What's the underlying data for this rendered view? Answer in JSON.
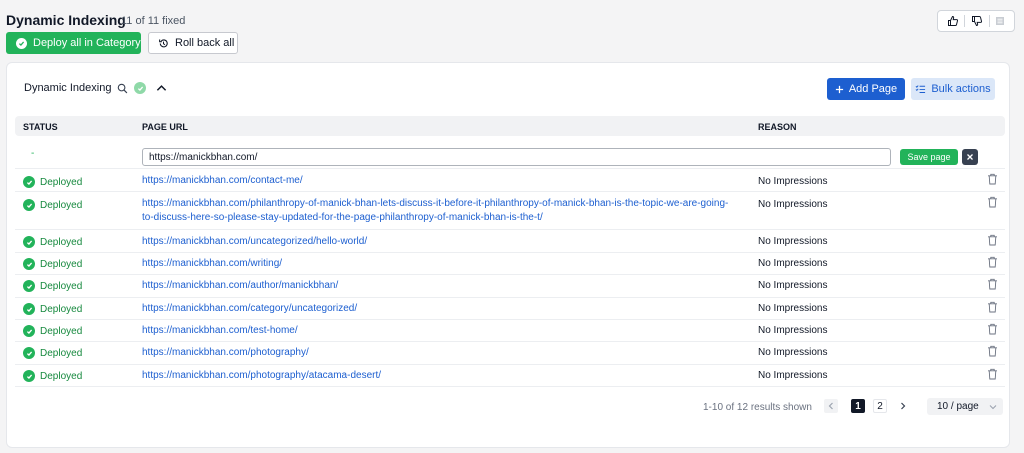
{
  "header": {
    "title": "Dynamic Indexing",
    "subtitle": "11 of 11 fixed",
    "deploy_label": "Deploy all in Category",
    "rollback_label": "Roll back all"
  },
  "card": {
    "title": "Dynamic Indexing",
    "add_page_label": "Add Page",
    "bulk_actions_label": "Bulk actions"
  },
  "table": {
    "columns": [
      "STATUS",
      "PAGE URL",
      "REASON"
    ],
    "edit_row": {
      "status": "-",
      "url_value": "https://manickbhan.com/",
      "save_label": "Save page"
    },
    "rows": [
      {
        "status": "Deployed",
        "url": "https://manickbhan.com/contact-me/",
        "reason": "No Impressions"
      },
      {
        "status": "Deployed",
        "url": "https://manickbhan.com/philanthropy-of-manick-bhan-lets-discuss-it-before-it-philanthropy-of-manick-bhan-is-the-topic-we-are-going-to-discuss-here-so-please-stay-updated-for-the-page-philanthropy-of-manick-bhan-is-the-t/",
        "reason": "No Impressions"
      },
      {
        "status": "Deployed",
        "url": "https://manickbhan.com/uncategorized/hello-world/",
        "reason": "No Impressions"
      },
      {
        "status": "Deployed",
        "url": "https://manickbhan.com/writing/",
        "reason": "No Impressions"
      },
      {
        "status": "Deployed",
        "url": "https://manickbhan.com/author/manickbhan/",
        "reason": "No Impressions"
      },
      {
        "status": "Deployed",
        "url": "https://manickbhan.com/category/uncategorized/",
        "reason": "No Impressions"
      },
      {
        "status": "Deployed",
        "url": "https://manickbhan.com/test-home/",
        "reason": "No Impressions"
      },
      {
        "status": "Deployed",
        "url": "https://manickbhan.com/photography/",
        "reason": "No Impressions"
      },
      {
        "status": "Deployed",
        "url": "https://manickbhan.com/photography/atacama-desert/",
        "reason": "No Impressions"
      }
    ]
  },
  "pagination": {
    "summary": "1-10 of 12 results shown",
    "pages": [
      "1",
      "2"
    ],
    "current_page": "1",
    "per_page": "10 / page"
  },
  "colors": {
    "success": "#22b35a",
    "primary": "#1d5fd0",
    "link": "#1d5fd0"
  },
  "icons": {
    "deploy": "check-circle-icon",
    "rollback": "history-icon",
    "thumbs_up": "thumbs-up-icon",
    "thumbs_down": "thumbs-down-icon",
    "menu": "list-icon",
    "search": "search-icon",
    "collapse": "chevron-up-icon",
    "add": "plus-icon",
    "bulk": "bulk-list-icon",
    "close": "close-icon",
    "delete": "trash-icon"
  }
}
